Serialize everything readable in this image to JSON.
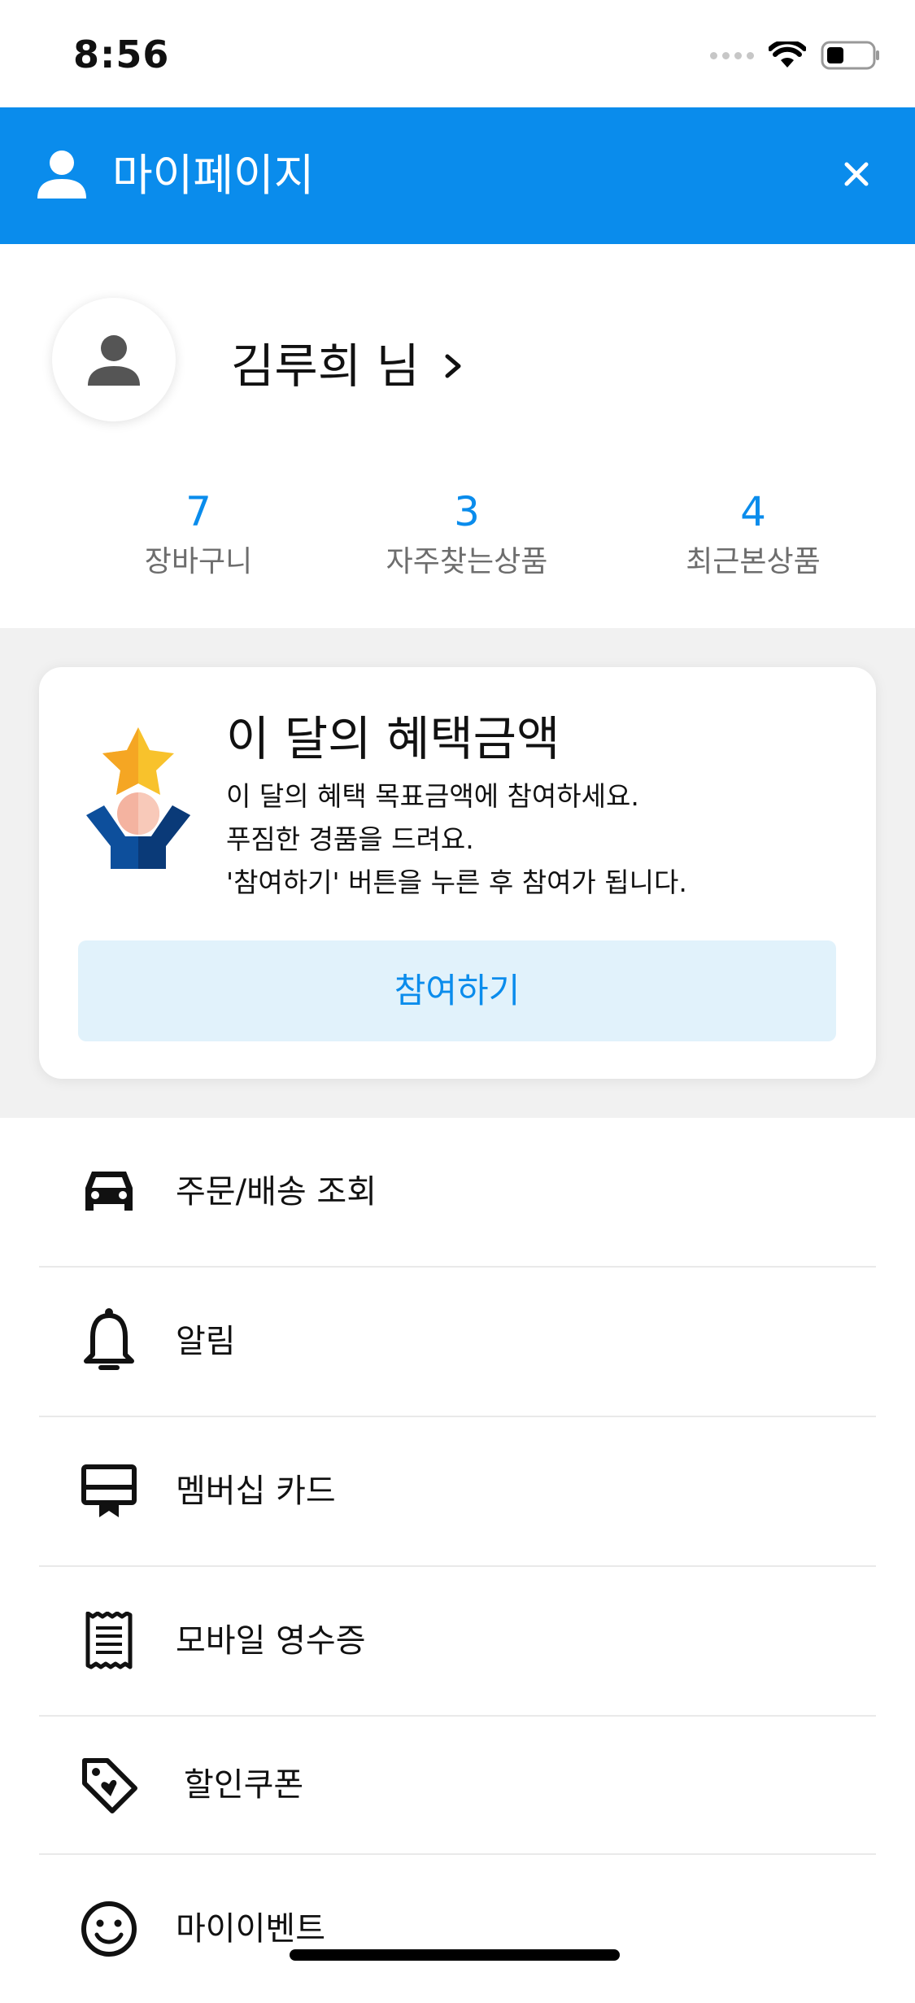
{
  "status_bar": {
    "time": "8:56"
  },
  "header": {
    "title": "마이페이지",
    "icons": {
      "left": "person-icon",
      "right": "close-icon"
    },
    "color": "#0a8cec"
  },
  "profile": {
    "name": "김루희 님",
    "chevron": ">"
  },
  "stats": [
    {
      "value": "7",
      "label": "장바구니"
    },
    {
      "value": "3",
      "label": "자주찾는상품"
    },
    {
      "value": "4",
      "label": "최근본상품"
    }
  ],
  "benefit_card": {
    "title": "이 달의 혜택금액",
    "lines": [
      "이 달의 혜택 목표금액에 참여하세요.",
      "푸짐한 경품을 드려요.",
      "'참여하기' 버튼을 누른 후 참여가 됩니다."
    ],
    "button_label": "참여하기",
    "icon": "star-trophy-person-icon"
  },
  "menu": [
    {
      "label": "주문/배송 조회",
      "icon": "car-icon"
    },
    {
      "label": "알림",
      "icon": "bell-icon"
    },
    {
      "label": "멤버십 카드",
      "icon": "membership-card-icon"
    },
    {
      "label": "모바일 영수증",
      "icon": "receipt-icon"
    },
    {
      "label": "할인쿠폰",
      "icon": "coupon-tag-icon"
    },
    {
      "label": "마이이벤트",
      "icon": "smiley-icon"
    }
  ],
  "colors": {
    "accent": "#0a8cec",
    "button_bg": "#e1f2fb",
    "band_bg": "#f1f1f1"
  }
}
